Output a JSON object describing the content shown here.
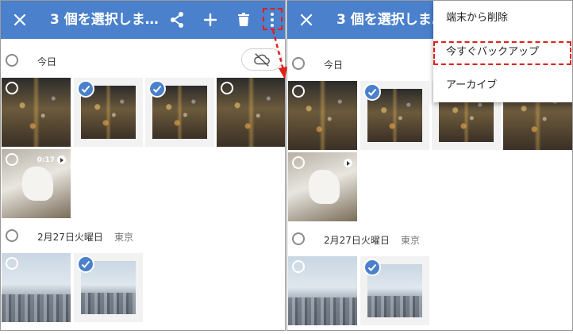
{
  "toolbar": {
    "title_left": "3 個を選択しま…",
    "title_right": "3 個を選択しま…"
  },
  "sections": {
    "today_label": "今日",
    "date2_label": "2月27日火曜日",
    "place2_label": "東京"
  },
  "video": {
    "duration": "0:17"
  },
  "menu": {
    "items": [
      "端末から削除",
      "今すぐバックアップ",
      "アーカイブ"
    ]
  },
  "colors": {
    "accent": "#4a80cc",
    "highlight": "#e0201b"
  },
  "icons": [
    "close-icon",
    "share-icon",
    "add-icon",
    "delete-icon",
    "more-vert-icon",
    "cloud-off-icon",
    "check-icon",
    "play-icon"
  ]
}
